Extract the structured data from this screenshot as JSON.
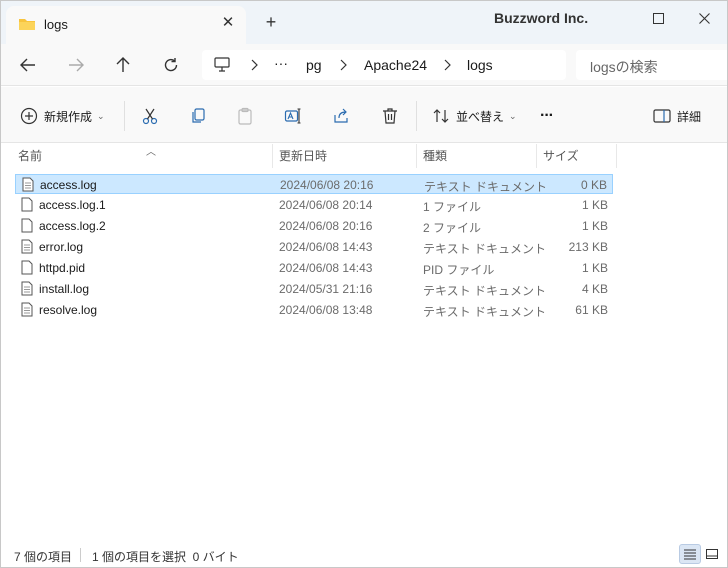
{
  "titlebar": {
    "tab_title": "logs",
    "watermark": "Buzzword Inc.",
    "close_tab_glyph": "✕",
    "new_tab_glyph": "+"
  },
  "navigation": {
    "breadcrumb": [
      "pg",
      "Apache24",
      "logs"
    ],
    "overflow_glyph": "···",
    "search_placeholder": "logsの検索"
  },
  "toolbar": {
    "new_label": "新規作成",
    "sort_label": "並べ替え",
    "details_label": "詳細",
    "more_glyph": "···"
  },
  "columns": {
    "name": "名前",
    "date": "更新日時",
    "type": "種類",
    "size": "サイズ"
  },
  "files": [
    {
      "name": "access.log",
      "date": "2024/06/08 20:16",
      "type": "テキスト ドキュメント",
      "size": "0 KB",
      "selected": true
    },
    {
      "name": "access.log.1",
      "date": "2024/06/08 20:14",
      "type": "1 ファイル",
      "size": "1 KB",
      "selected": false
    },
    {
      "name": "access.log.2",
      "date": "2024/06/08 20:16",
      "type": "2 ファイル",
      "size": "1 KB",
      "selected": false
    },
    {
      "name": "error.log",
      "date": "2024/06/08 14:43",
      "type": "テキスト ドキュメント",
      "size": "213 KB",
      "selected": false
    },
    {
      "name": "httpd.pid",
      "date": "2024/06/08 14:43",
      "type": "PID ファイル",
      "size": "1 KB",
      "selected": false
    },
    {
      "name": "install.log",
      "date": "2024/05/31 21:16",
      "type": "テキスト ドキュメント",
      "size": "4 KB",
      "selected": false
    },
    {
      "name": "resolve.log",
      "date": "2024/06/08 13:48",
      "type": "テキスト ドキュメント",
      "size": "61 KB",
      "selected": false
    }
  ],
  "status": {
    "item_count": "7 個の項目",
    "selection": "1 個の項目を選択  0 バイト"
  },
  "colors": {
    "titlebar_bg": "#eff4f9",
    "selection_bg": "#cce8ff",
    "selection_border": "#99d1ff",
    "folder_yellow": "#f8c43d"
  },
  "icons": {
    "tab": "folder-icon",
    "back": "arrow-left-icon",
    "forward": "arrow-right-icon",
    "up": "arrow-up-icon",
    "refresh": "refresh-icon",
    "computer": "monitor-icon",
    "new": "plus-circle-icon",
    "cut": "scissors-icon",
    "copy": "copy-icon",
    "paste": "clipboard-icon",
    "rename": "rename-icon",
    "share": "share-icon",
    "delete": "trash-icon",
    "sort": "sort-icon",
    "details": "details-pane-icon",
    "file": "document-icon"
  }
}
